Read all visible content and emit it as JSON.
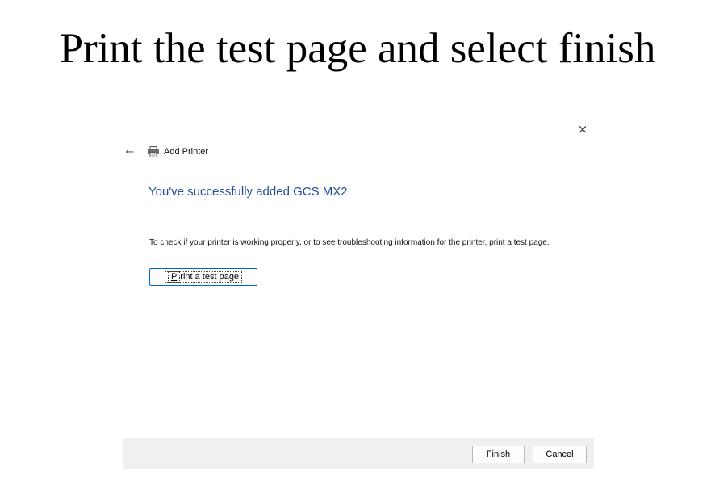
{
  "slide": {
    "title": "Print the test page and select finish"
  },
  "dialog": {
    "close_label": "×",
    "back_label": "←",
    "wizard_title": "Add Printer",
    "heading": "You've successfully added GCS MX2",
    "info_text": "To check if your printer is working properly, or to see troubleshooting information for the printer, print a test page.",
    "test_page_button": {
      "accel": "P",
      "rest": "rint a test page"
    },
    "finish_button": {
      "accel": "F",
      "rest": "inish"
    },
    "cancel_button": "Cancel"
  },
  "icons": {
    "printer": "printer-icon",
    "back": "back-arrow-icon",
    "close": "close-icon"
  },
  "colors": {
    "heading": "#1f4e9c",
    "footer_bg": "#f0f0f0",
    "focus_border": "#0066cc"
  }
}
